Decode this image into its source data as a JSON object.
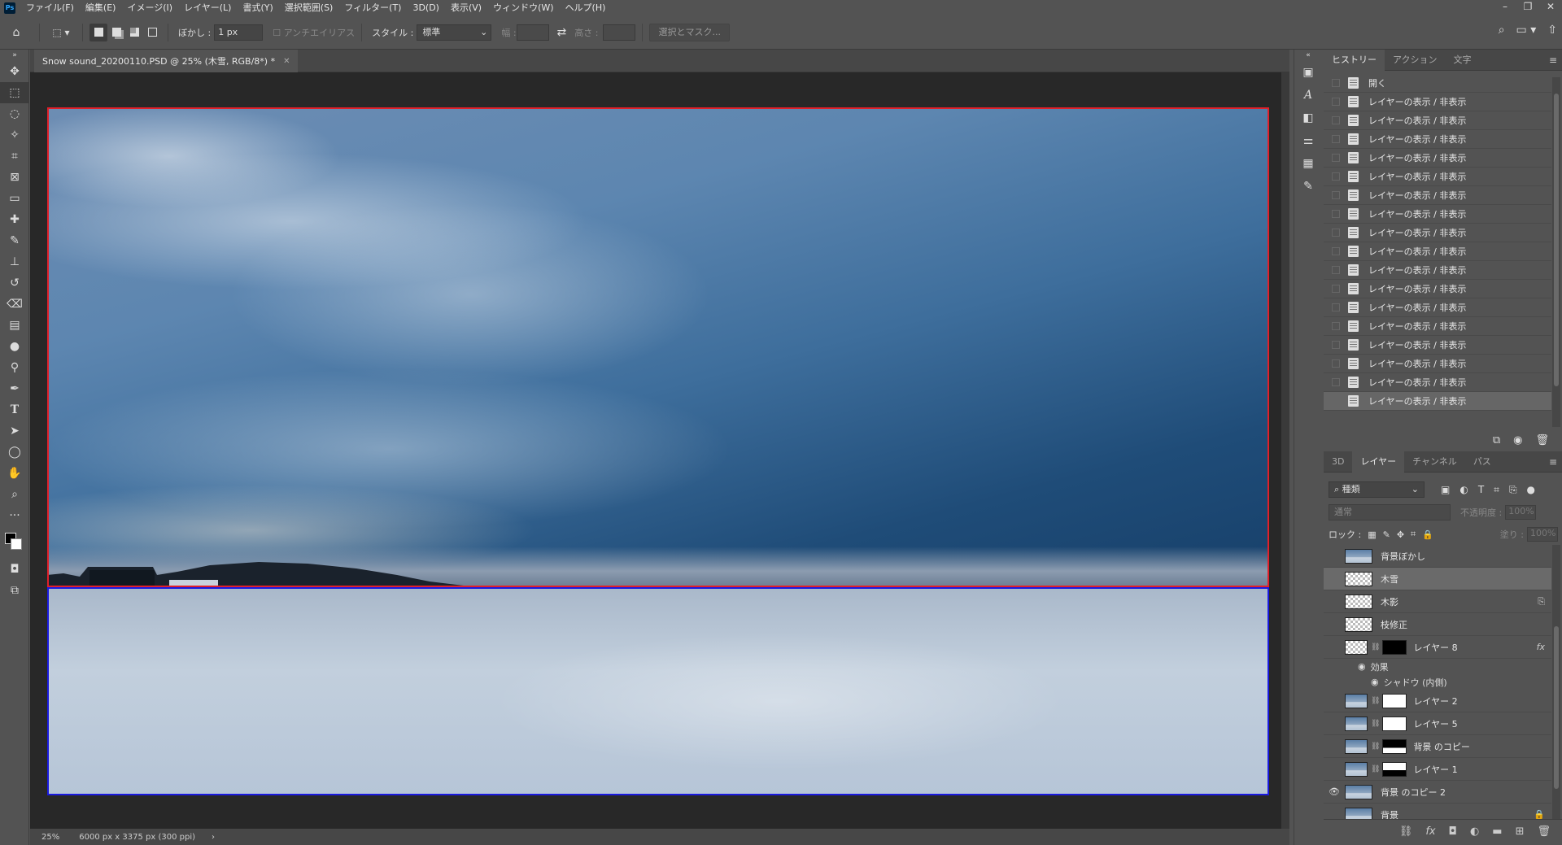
{
  "menubar": {
    "logo": "Ps",
    "items": [
      "ファイル(F)",
      "編集(E)",
      "イメージ(I)",
      "レイヤー(L)",
      "書式(Y)",
      "選択範囲(S)",
      "フィルター(T)",
      "3D(D)",
      "表示(V)",
      "ウィンドウ(W)",
      "ヘルプ(H)"
    ]
  },
  "options": {
    "feather_label": "ぼかし :",
    "feather_value": "1 px",
    "antialias_label": "アンチエイリアス",
    "style_label": "スタイル :",
    "style_value": "標準",
    "width_label": "幅 :",
    "height_label": "高さ :",
    "select_mask_label": "選択とマスク..."
  },
  "document": {
    "tab_title": "Snow sound_20200110.PSD @ 25% (木雪, RGB/8*) *"
  },
  "status": {
    "zoom": "25%",
    "doc_info": "6000 px x 3375 px (300 ppi)"
  },
  "history": {
    "tabs": [
      "ヒストリー",
      "アクション",
      "文字"
    ],
    "items": [
      "開く",
      "レイヤーの表示 / 非表示",
      "レイヤーの表示 / 非表示",
      "レイヤーの表示 / 非表示",
      "レイヤーの表示 / 非表示",
      "レイヤーの表示 / 非表示",
      "レイヤーの表示 / 非表示",
      "レイヤーの表示 / 非表示",
      "レイヤーの表示 / 非表示",
      "レイヤーの表示 / 非表示",
      "レイヤーの表示 / 非表示",
      "レイヤーの表示 / 非表示",
      "レイヤーの表示 / 非表示",
      "レイヤーの表示 / 非表示",
      "レイヤーの表示 / 非表示",
      "レイヤーの表示 / 非表示",
      "レイヤーの表示 / 非表示",
      "レイヤーの表示 / 非表示"
    ]
  },
  "layers": {
    "tabs": [
      "3D",
      "レイヤー",
      "チャンネル",
      "パス"
    ],
    "filter_kind": "種類",
    "blend_mode": "通常",
    "opacity_label": "不透明度 :",
    "opacity_value": "100%",
    "lock_label": "ロック :",
    "fill_label": "塗り :",
    "fill_value": "100%",
    "items": [
      {
        "name": "背景ぼかし",
        "visible": false
      },
      {
        "name": "木雪",
        "visible": false
      },
      {
        "name": "木影",
        "visible": false
      },
      {
        "name": "枝修正",
        "visible": false
      },
      {
        "name": "レイヤー 8",
        "visible": false
      },
      {
        "name": "レイヤー 2",
        "visible": false
      },
      {
        "name": "レイヤー 5",
        "visible": false
      },
      {
        "name": "背景 のコピー",
        "visible": false
      },
      {
        "name": "レイヤー 1",
        "visible": false
      },
      {
        "name": "背景 のコピー 2",
        "visible": true
      },
      {
        "name": "背景",
        "visible": false
      }
    ],
    "effects_label": "効果",
    "effect_name": "シャドウ (内側)",
    "fx_label": "fx"
  }
}
